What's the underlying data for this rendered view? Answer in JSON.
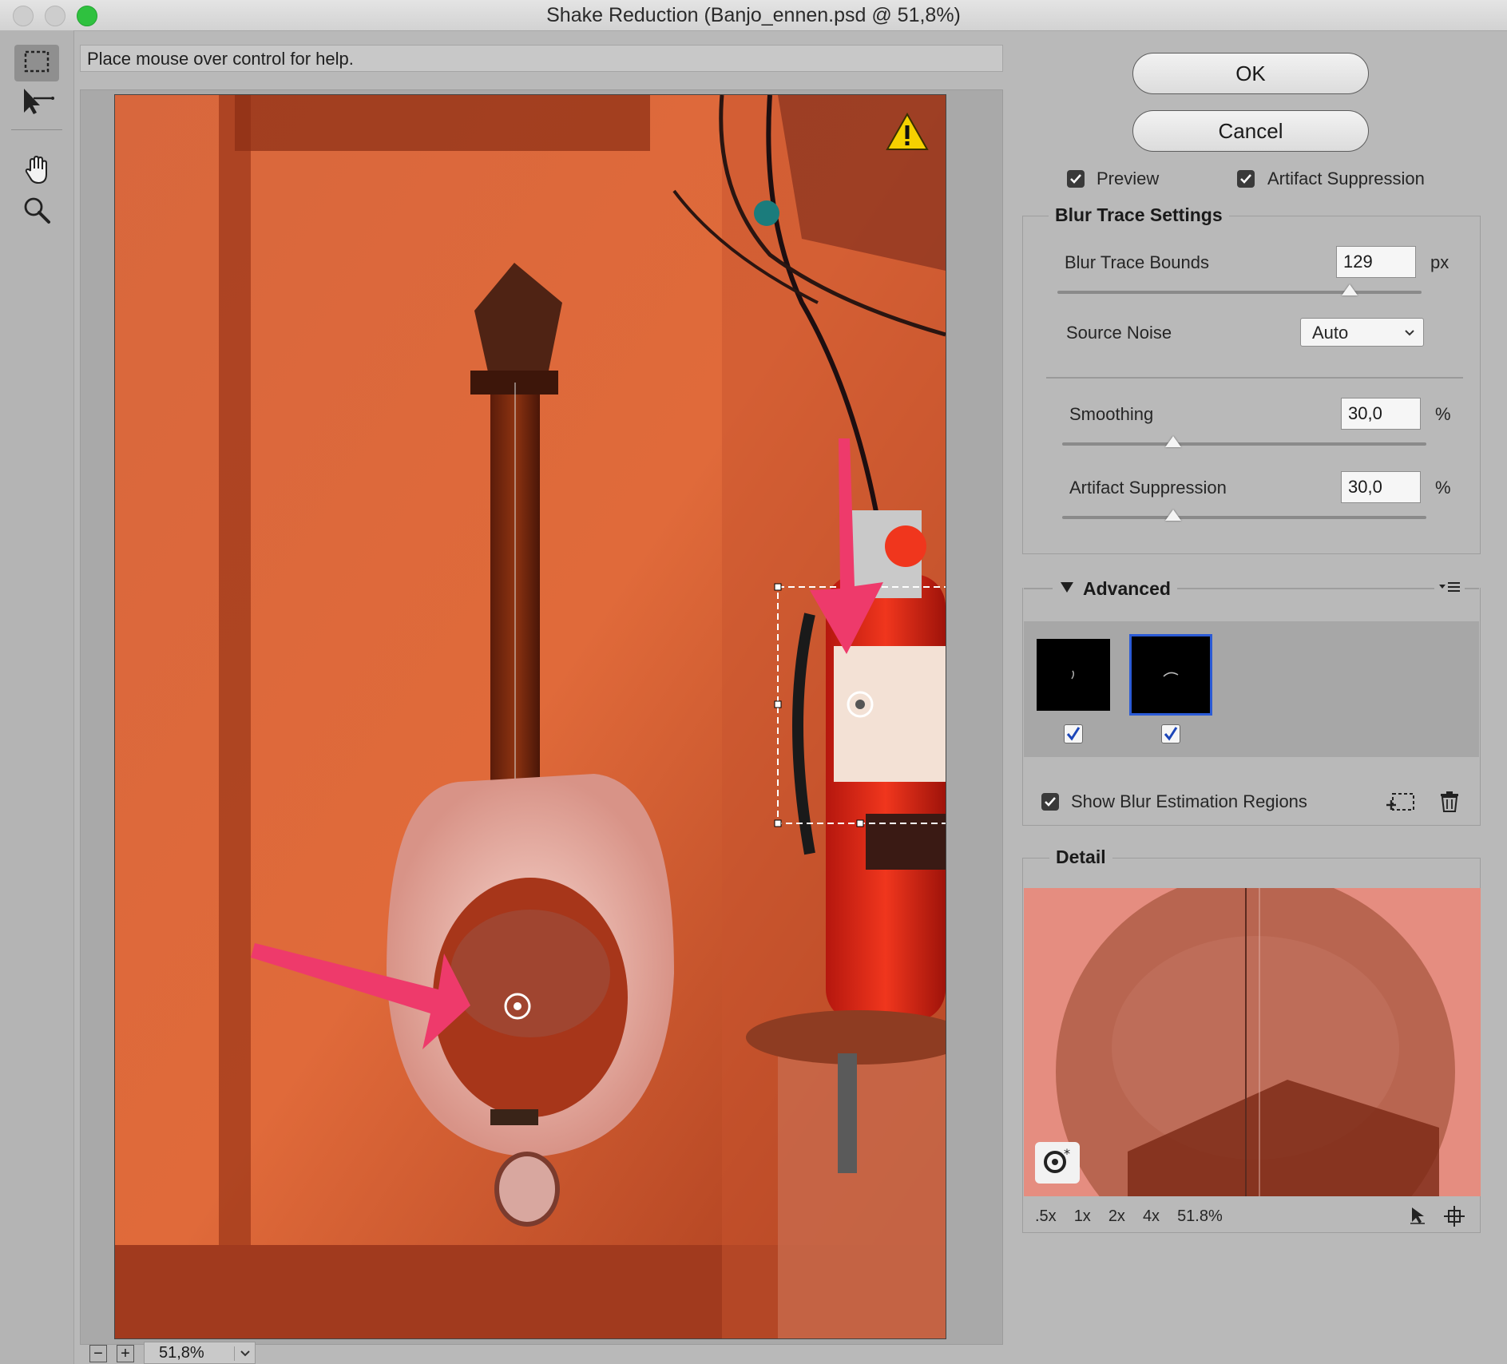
{
  "window": {
    "title": "Shake Reduction (Banjo_ennen.psd @ 51,8%)",
    "traffic_lights": {
      "close": "#c9c9c9",
      "minimize": "#c9c9c9",
      "zoom": "#2fc13f"
    }
  },
  "help": {
    "text": "Place mouse over control for help."
  },
  "tools": [
    {
      "name": "blur-estimation-tool-icon",
      "selected": true
    },
    {
      "name": "blur-direction-tool-icon",
      "selected": false
    },
    {
      "name": "hand-tool-icon",
      "selected": false
    },
    {
      "name": "zoom-tool-icon",
      "selected": false
    }
  ],
  "canvas": {
    "warning_icon": "warning-icon",
    "arrow_color": "#ee3a6b"
  },
  "zoom_bar": {
    "value": "51,8%",
    "minus": "−",
    "plus": "+"
  },
  "buttons": {
    "ok": "OK",
    "cancel": "Cancel"
  },
  "options": {
    "preview": {
      "label": "Preview",
      "checked": true
    },
    "artifact_suppression": {
      "label": "Artifact Suppression",
      "checked": true
    }
  },
  "blur_trace": {
    "heading": "Blur Trace Settings",
    "bounds": {
      "label": "Blur Trace Bounds",
      "value": "129",
      "unit": "px",
      "slider_fraction": 0.8
    },
    "source_noise": {
      "label": "Source Noise",
      "value": "Auto"
    },
    "smoothing": {
      "label": "Smoothing",
      "value": "30,0",
      "unit": "%",
      "slider_fraction": 0.3
    },
    "artifact_suppression": {
      "label": "Artifact Suppression",
      "value": "30,0",
      "unit": "%",
      "slider_fraction": 0.3
    }
  },
  "advanced": {
    "heading": "Advanced",
    "traces": [
      {
        "checked": true,
        "selected": false
      },
      {
        "checked": true,
        "selected": true
      }
    ],
    "show_regions": {
      "label": "Show Blur Estimation Regions",
      "checked": true
    }
  },
  "detail": {
    "heading": "Detail",
    "zoom_options": [
      ".5x",
      "1x",
      "2x",
      "4x",
      "51.8%"
    ]
  }
}
